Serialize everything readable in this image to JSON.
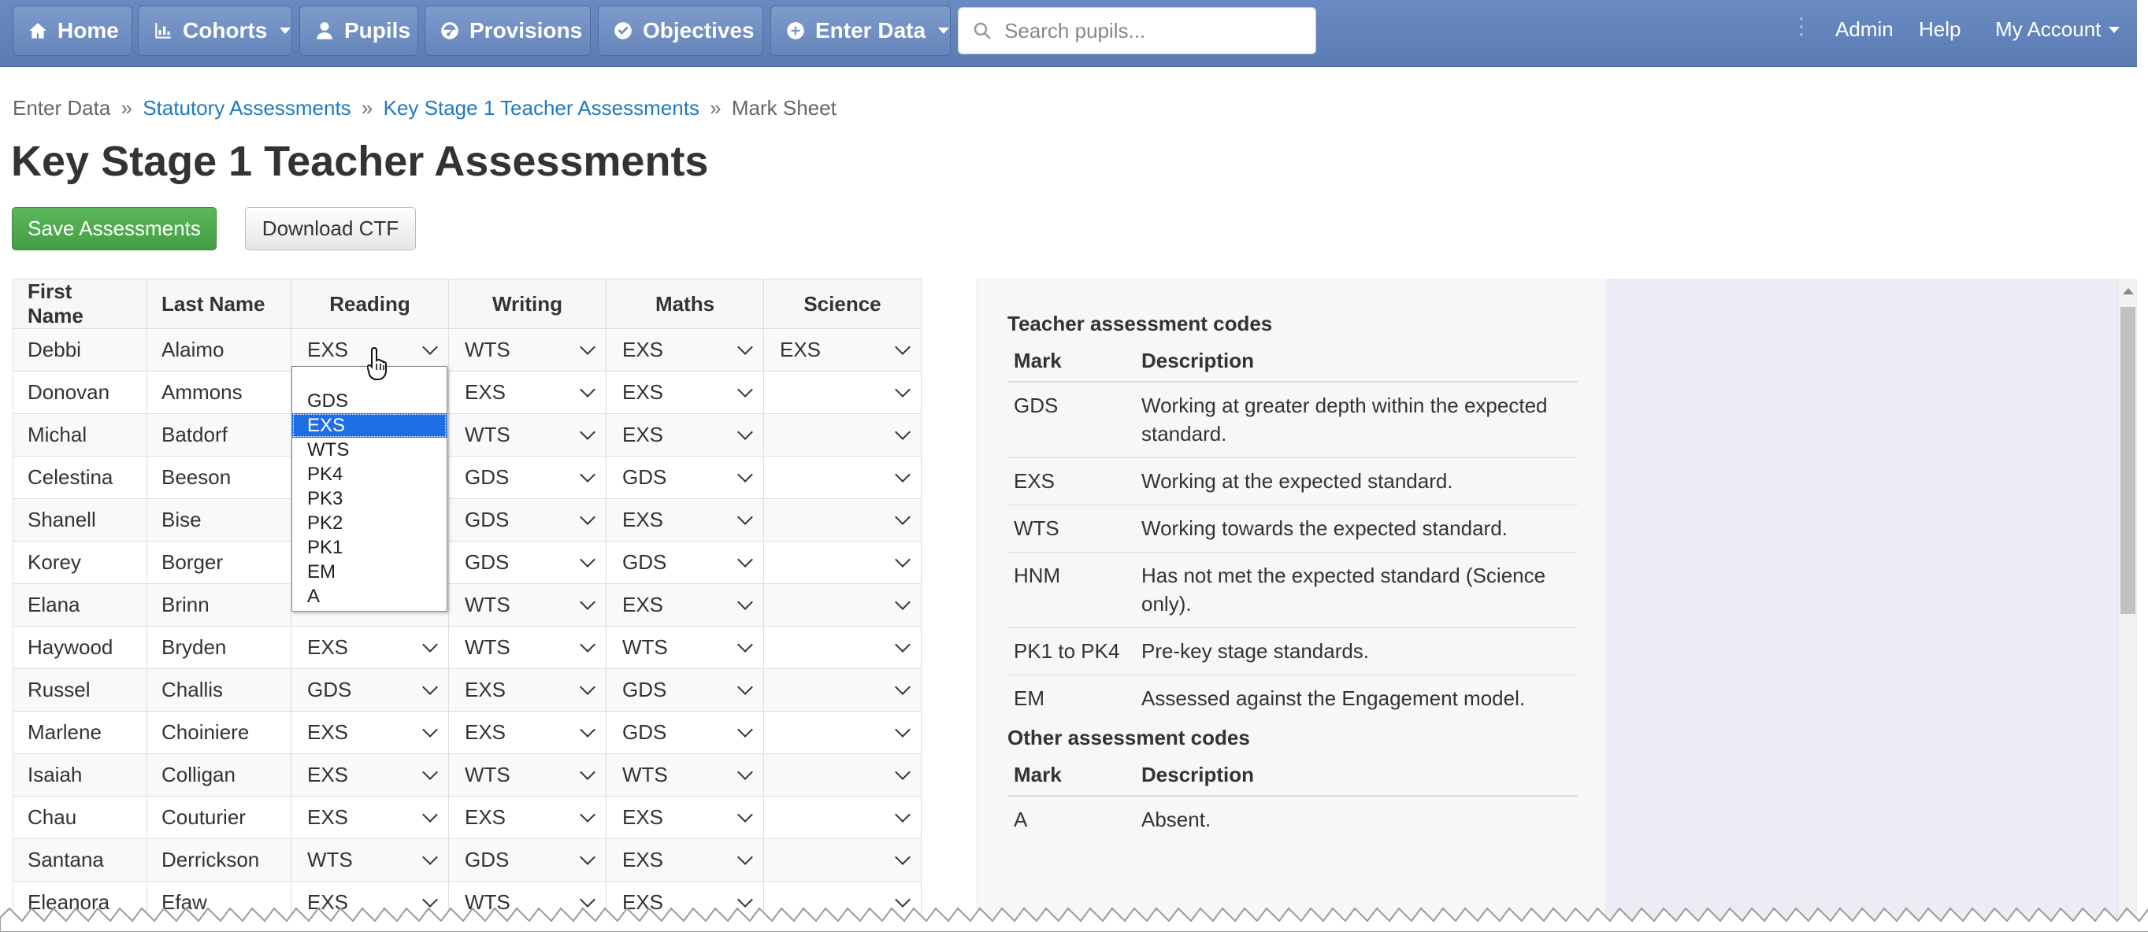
{
  "navbar": {
    "home": "Home",
    "cohorts": "Cohorts",
    "pupils": "Pupils",
    "provisions": "Provisions",
    "objectives": "Objectives",
    "enter_data": "Enter Data",
    "search_placeholder": "Search pupils...",
    "admin": "Admin",
    "help": "Help",
    "my_account": "My Account"
  },
  "breadcrumb": {
    "item1": "Enter Data",
    "item2": "Statutory Assessments",
    "item3": "Key Stage 1 Teacher Assessments",
    "item4": "Mark Sheet",
    "separator": "»"
  },
  "page_title": "Key Stage 1 Teacher Assessments",
  "buttons": {
    "save": "Save Assessments",
    "download": "Download CTF"
  },
  "sheet": {
    "headers": [
      "First Name",
      "Last Name",
      "Reading",
      "Writing",
      "Maths",
      "Science"
    ],
    "rows": [
      {
        "first": "Debbi",
        "last": "Alaimo",
        "reading": "EXS",
        "writing": "WTS",
        "maths": "EXS",
        "science": "EXS"
      },
      {
        "first": "Donovan",
        "last": "Ammons",
        "reading": "",
        "writing": "EXS",
        "maths": "EXS",
        "science": ""
      },
      {
        "first": "Michal",
        "last": "Batdorf",
        "reading": "",
        "writing": "WTS",
        "maths": "EXS",
        "science": ""
      },
      {
        "first": "Celestina",
        "last": "Beeson",
        "reading": "",
        "writing": "GDS",
        "maths": "GDS",
        "science": ""
      },
      {
        "first": "Shanell",
        "last": "Bise",
        "reading": "",
        "writing": "GDS",
        "maths": "EXS",
        "science": ""
      },
      {
        "first": "Korey",
        "last": "Borger",
        "reading": "",
        "writing": "GDS",
        "maths": "GDS",
        "science": ""
      },
      {
        "first": "Elana",
        "last": "Brinn",
        "reading": "",
        "writing": "WTS",
        "maths": "EXS",
        "science": ""
      },
      {
        "first": "Haywood",
        "last": "Bryden",
        "reading": "EXS",
        "writing": "WTS",
        "maths": "WTS",
        "science": ""
      },
      {
        "first": "Russel",
        "last": "Challis",
        "reading": "GDS",
        "writing": "EXS",
        "maths": "GDS",
        "science": ""
      },
      {
        "first": "Marlene",
        "last": "Choiniere",
        "reading": "EXS",
        "writing": "EXS",
        "maths": "GDS",
        "science": ""
      },
      {
        "first": "Isaiah",
        "last": "Colligan",
        "reading": "EXS",
        "writing": "WTS",
        "maths": "WTS",
        "science": ""
      },
      {
        "first": "Chau",
        "last": "Couturier",
        "reading": "EXS",
        "writing": "EXS",
        "maths": "EXS",
        "science": ""
      },
      {
        "first": "Santana",
        "last": "Derrickson",
        "reading": "WTS",
        "writing": "GDS",
        "maths": "EXS",
        "science": ""
      },
      {
        "first": "Eleanora",
        "last": "Efaw",
        "reading": "EXS",
        "writing": "WTS",
        "maths": "EXS",
        "science": ""
      }
    ]
  },
  "dropdown": {
    "options": [
      "",
      "GDS",
      "EXS",
      "WTS",
      "PK4",
      "PK3",
      "PK2",
      "PK1",
      "EM",
      "A"
    ],
    "selected": "EXS"
  },
  "reference": {
    "teacher_heading": "Teacher assessment codes",
    "other_heading": "Other assessment codes",
    "col_mark": "Mark",
    "col_description": "Description",
    "teacher_codes": [
      {
        "mark": "GDS",
        "desc": "Working at greater depth within the expected standard."
      },
      {
        "mark": "EXS",
        "desc": "Working at the expected standard."
      },
      {
        "mark": "WTS",
        "desc": "Working towards the expected standard."
      },
      {
        "mark": "HNM",
        "desc": "Has not met the expected standard (Science only)."
      },
      {
        "mark": "PK1 to PK4",
        "desc": "Pre-key stage standards."
      },
      {
        "mark": "EM",
        "desc": "Assessed against the Engagement model."
      }
    ],
    "other_codes": [
      {
        "mark": "A",
        "desc": "Absent."
      }
    ]
  }
}
